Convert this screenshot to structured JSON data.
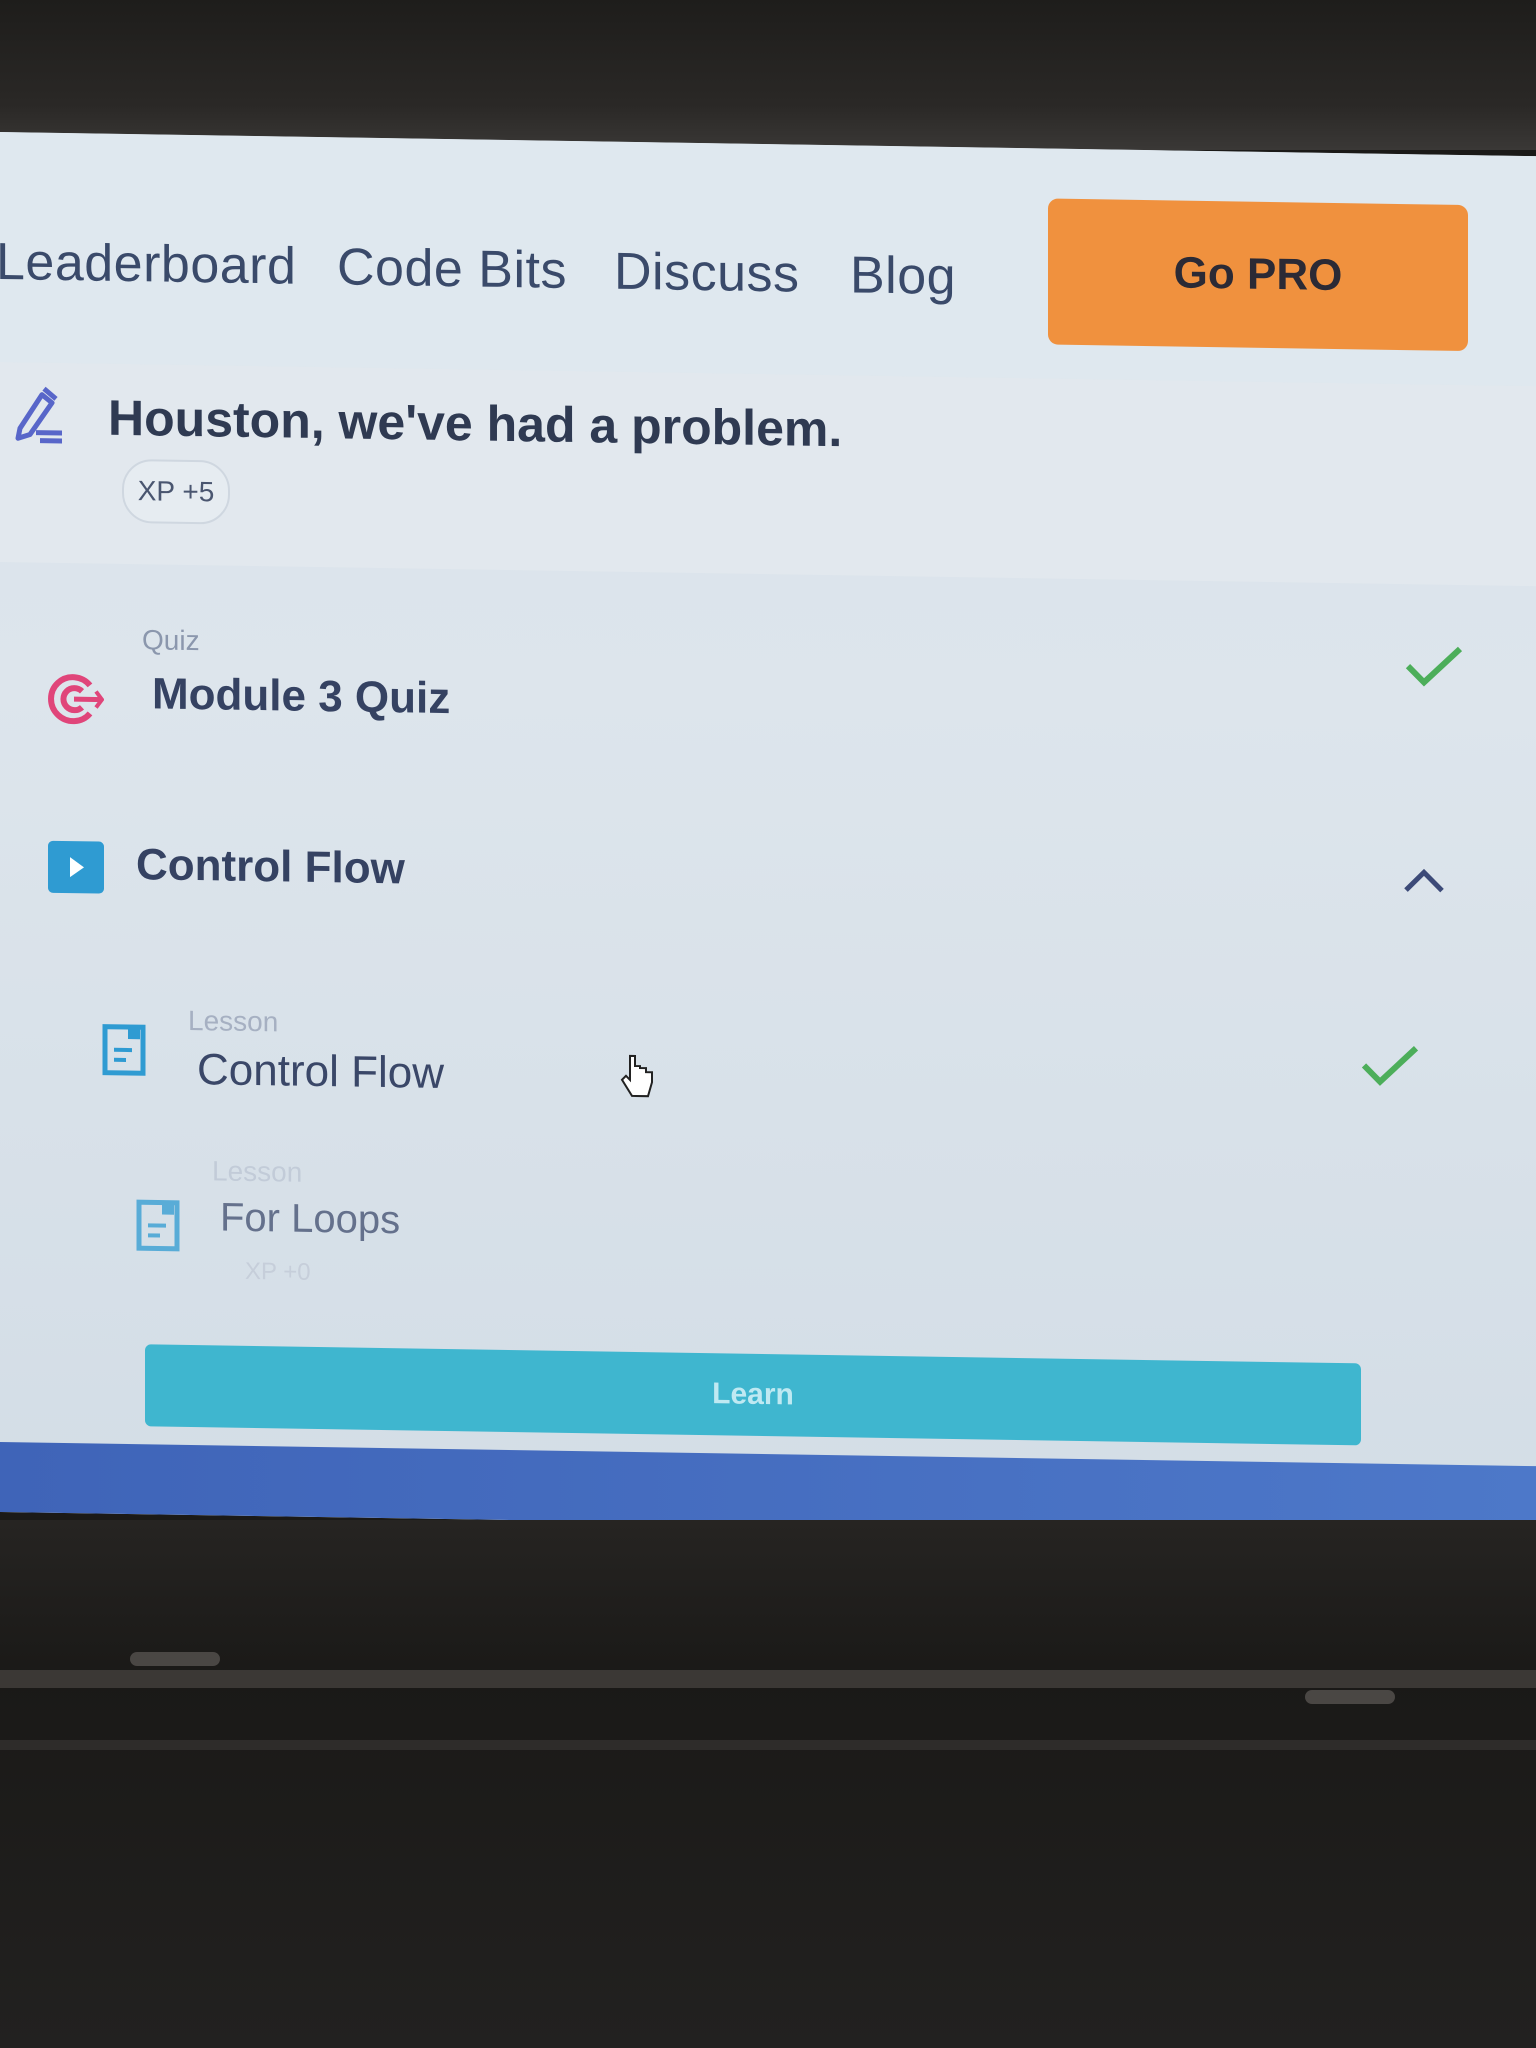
{
  "nav": {
    "links": [
      "Leaderboard",
      "Code Bits",
      "Discuss",
      "Blog"
    ],
    "cta_label": "Go PRO",
    "cta_color": "#f0913e"
  },
  "challenge": {
    "title": "Houston, we've had a problem.",
    "xp_badge": "XP +5",
    "icon": "pen-icon"
  },
  "quiz": {
    "label": "Quiz",
    "title": "Module 3 Quiz",
    "completed": true,
    "icon": "target-icon"
  },
  "module": {
    "title": "Control Flow",
    "expanded": true,
    "icon": "play-icon",
    "lessons": [
      {
        "label": "Lesson",
        "title": "Control Flow",
        "completed": true
      },
      {
        "label": "Lesson",
        "title": "For Loops",
        "xp": "XP +0",
        "completed": false
      }
    ]
  },
  "learn_button": {
    "label": "Learn",
    "color": "#3fb6cf"
  },
  "colors": {
    "check": "#4cae5a",
    "accent": "#2f9bd2",
    "quiz_icon": "#e0457a"
  }
}
